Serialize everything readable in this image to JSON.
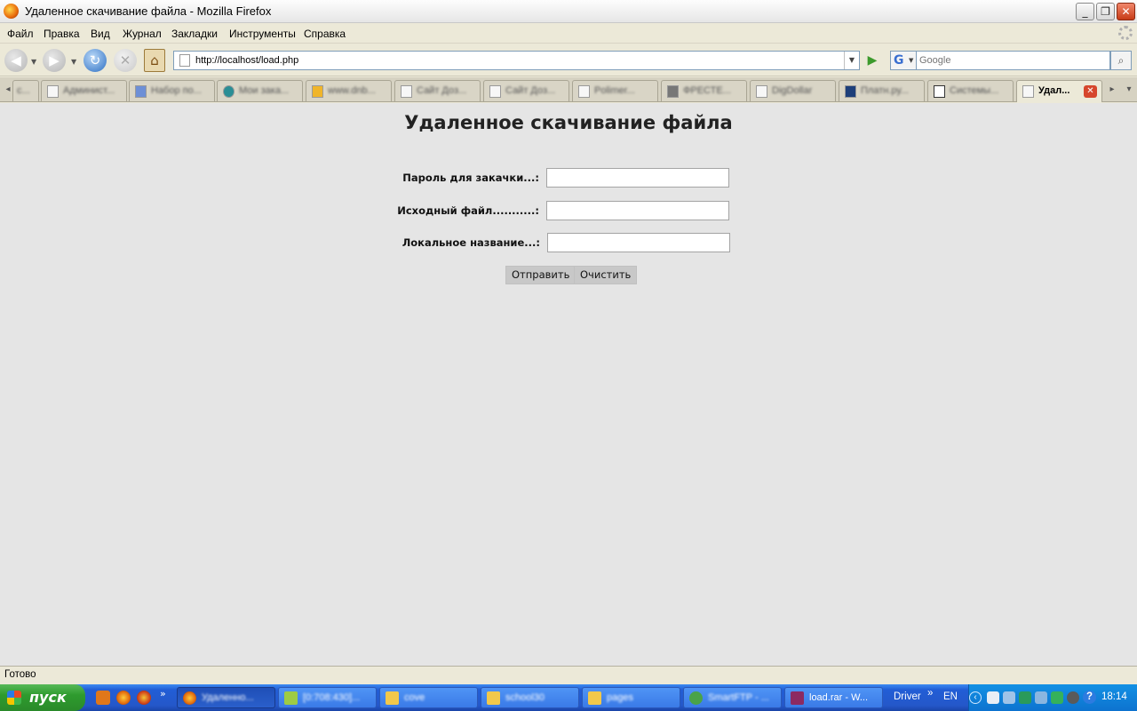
{
  "window": {
    "title": "Удаленное скачивание файла - Mozilla Firefox",
    "min_glyph": "_",
    "max_glyph": "❐",
    "close_glyph": "✕"
  },
  "menu": [
    "Файл",
    "Правка",
    "Вид",
    "Журнал",
    "Закладки",
    "Инструменты",
    "Справка"
  ],
  "nav": {
    "back_glyph": "◀",
    "forward_glyph": "▶",
    "reload_glyph": "↻",
    "stop_glyph": "✕",
    "home_glyph": "⌂",
    "url": "http://localhost/load.php",
    "dropdown_glyph": "▼",
    "go_glyph": "▶",
    "search_engine_glyph": "G",
    "search_placeholder": "Google",
    "search_glyph": "⌕"
  },
  "tabs": [
    {
      "label": "с..."
    },
    {
      "label": "Админист..."
    },
    {
      "label": "Набор по..."
    },
    {
      "label": "Мои зака..."
    },
    {
      "label": "www.dnb..."
    },
    {
      "label": "Сайт Доз..."
    },
    {
      "label": "Сайт Доз..."
    },
    {
      "label": "Polimer..."
    },
    {
      "label": "ФРЕСТЕ..."
    },
    {
      "label": "DigDollar"
    },
    {
      "label": "Платн.ру..."
    },
    {
      "label": "Системы..."
    },
    {
      "label": "Удал..."
    }
  ],
  "tab_close_glyph": "✕",
  "tab_scroll_left": "◂",
  "tab_scroll_right": "▸",
  "tab_list": "▾",
  "page": {
    "title": "Удаленное скачивание файла",
    "fields": [
      {
        "label": "Пароль для закачки...:",
        "value": ""
      },
      {
        "label": "Исходный файл...........:",
        "value": ""
      },
      {
        "label": "Локальное название...:",
        "value": ""
      }
    ],
    "submit_label": "Отправить",
    "reset_label": "Очистить"
  },
  "status": "Готово",
  "taskbar": {
    "start_label": "пуск",
    "quicklaunch_more": "»",
    "tasks": [
      {
        "label": "Удаленно..."
      },
      {
        "label": "[0:708:430]..."
      },
      {
        "label": "cove"
      },
      {
        "label": "school30"
      },
      {
        "label": "pages"
      },
      {
        "label": "SmartFTP - ..."
      },
      {
        "label": "load.rar - W..."
      }
    ],
    "driver_label": "Driver",
    "driver_more": "»",
    "lang": "EN",
    "time": "18:14",
    "tray_collapse": "‹",
    "help_glyph": "?"
  }
}
